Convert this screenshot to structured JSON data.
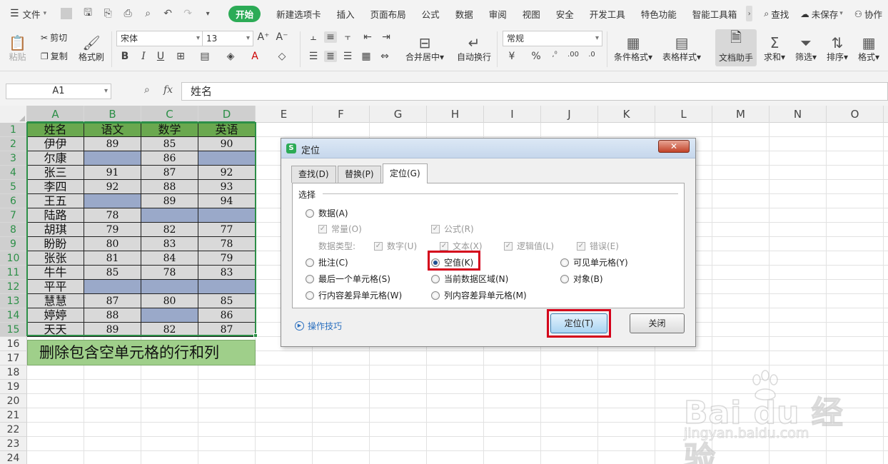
{
  "ribbon_tabs": {
    "file_menu": "文件",
    "tabs": [
      "开始",
      "新建选项卡",
      "插入",
      "页面布局",
      "公式",
      "数据",
      "审阅",
      "视图",
      "安全",
      "开发工具",
      "特色功能",
      "智能工具箱"
    ],
    "active_index": 0,
    "search": "查找",
    "save_status": "未保存",
    "collab": "协作"
  },
  "ribbon": {
    "paste": "粘贴",
    "cut": "剪切",
    "copy": "复制",
    "format_painter": "格式刷",
    "font_name": "宋体",
    "font_size": "13",
    "merge_center": "合并居中",
    "wrap_text": "自动换行",
    "number_format": "常规",
    "conditional_format": "条件格式",
    "table_style": "表格样式",
    "doc_helper": "文档助手",
    "sum": "求和",
    "filter": "筛选",
    "sort": "排序",
    "format": "格式"
  },
  "formula_bar": {
    "cell_ref": "A1",
    "fx": "fx",
    "content": "姓名"
  },
  "sheet": {
    "columns": [
      "A",
      "B",
      "C",
      "D",
      "E",
      "F",
      "G",
      "H",
      "I",
      "J",
      "K",
      "L",
      "M",
      "N",
      "O"
    ],
    "row_numbers": [
      "1",
      "2",
      "3",
      "4",
      "5",
      "6",
      "7",
      "8",
      "9",
      "10",
      "11",
      "12",
      "13",
      "14",
      "15",
      "16",
      "17",
      "18",
      "19",
      "20",
      "21",
      "22",
      "23",
      "24"
    ],
    "header": [
      "姓名",
      "语文",
      "数学",
      "英语"
    ],
    "rows": [
      [
        "伊伊",
        "89",
        "85",
        "90"
      ],
      [
        "尔康",
        "",
        "86",
        ""
      ],
      [
        "张三",
        "91",
        "87",
        "92"
      ],
      [
        "李四",
        "92",
        "88",
        "93"
      ],
      [
        "王五",
        "",
        "89",
        "94"
      ],
      [
        "陆路",
        "78",
        "",
        ""
      ],
      [
        "胡琪",
        "79",
        "82",
        "77"
      ],
      [
        "盼盼",
        "80",
        "83",
        "78"
      ],
      [
        "张张",
        "81",
        "84",
        "79"
      ],
      [
        "牛牛",
        "85",
        "78",
        "83"
      ],
      [
        "平平",
        "",
        "",
        ""
      ],
      [
        "慧慧",
        "87",
        "80",
        "85"
      ],
      [
        "婷婷",
        "88",
        "",
        "86"
      ],
      [
        "天天",
        "89",
        "82",
        "87"
      ]
    ],
    "banner": "删除包含空单元格的行和列",
    "colors": {
      "header_fill": "#6aa84f",
      "empty_fill": "#9aa9c9",
      "cell_fill": "#d9d9d9",
      "banner_fill": "#9fcf8a"
    }
  },
  "dialog": {
    "title": "定位",
    "close_symbol": "✕",
    "tabs": [
      "查找(D)",
      "替换(P)",
      "定位(G)"
    ],
    "active_tab": 2,
    "section": "选择",
    "data_option": "数据(A)",
    "constants": "常量(O)",
    "formulas": "公式(R)",
    "data_type_label": "数据类型:",
    "numbers": "数字(U)",
    "text": "文本(X)",
    "logical": "逻辑值(L)",
    "errors": "错误(E)",
    "comments": "批注(C)",
    "blanks": "空值(K)",
    "visible_cells": "可见单元格(Y)",
    "last_cell": "最后一个单元格(S)",
    "current_region": "当前数据区域(N)",
    "objects": "对象(B)",
    "row_diff": "行内容差异单元格(W)",
    "col_diff": "列内容差异单元格(M)",
    "selected_option": "空值(K)",
    "tips": "操作技巧",
    "locate_button": "定位(T)",
    "close_button": "关闭",
    "highlight_color": "#d4001a"
  },
  "watermark": {
    "main": "Bai du 经验",
    "sub": "jingyan.baidu.com"
  }
}
